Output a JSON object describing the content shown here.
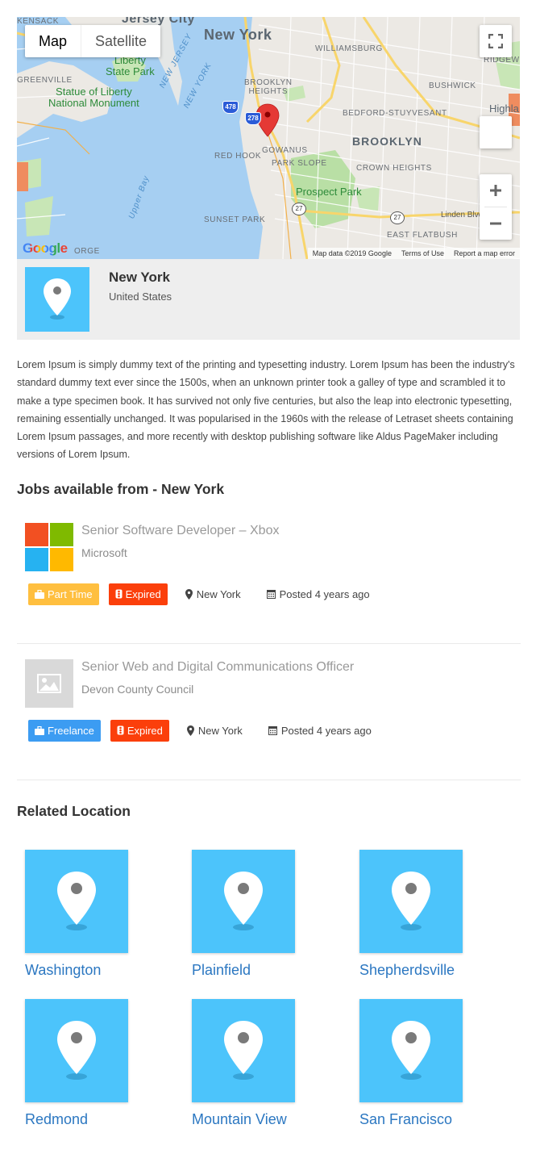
{
  "map": {
    "type_map": "Map",
    "type_satellite": "Satellite",
    "labels": {
      "jersey_city": "Jersey City",
      "new_york": "New York",
      "kensack": "KENSACK",
      "williamsburg": "WILLIAMSBURG",
      "ridgewood": "RIDGEWOOD",
      "liberty_state_park": "Liberty\nState Park",
      "greenville": "GREENVILLE",
      "statue_of_liberty": "Statue of Liberty\nNational Monument",
      "new_jersey": "NEW JERSEY",
      "new_york_water": "NEW YORK",
      "brooklyn_heights": "BROOKLYN\nHEIGHTS",
      "bushwick": "BUSHWICK",
      "bedford": "BEDFORD-STUYVESANT",
      "highland": "Highla",
      "brooklyn": "BROOKLYN",
      "gowanus": "GOWANUS",
      "red_hook": "RED HOOK",
      "park_slope": "PARK SLOPE",
      "crown_heights": "CROWN HEIGHTS",
      "upper_bay": "Upper Bay",
      "prospect_park": "Prospect Park",
      "linden_blvd": "Linden Blvd",
      "sunset_park": "SUNSET PARK",
      "east_flatbush": "EAST FLATBUSH",
      "gorge": "ORGE",
      "shield_478": "478",
      "shield_278": "278",
      "shield_27a": "27",
      "shield_27b": "27"
    },
    "footer": {
      "data": "Map data ©2019 Google",
      "terms": "Terms of Use",
      "report": "Report a map error"
    },
    "google": "Google"
  },
  "location": {
    "name": "New York",
    "country": "United States"
  },
  "description": "Lorem Ipsum is simply dummy text of the printing and typesetting industry. Lorem Ipsum has been the industry's standard dummy text ever since the 1500s, when an unknown printer took a galley of type and scrambled it to make a type specimen book. It has survived not only five centuries, but also the leap into electronic typesetting, remaining essentially unchanged. It was popularised in the 1960s with the release of Letraset sheets containing Lorem Ipsum passages, and more recently with desktop publishing software like Aldus PageMaker including versions of Lorem Ipsum.",
  "jobs_heading": "Jobs available from - New York",
  "jobs": [
    {
      "title": "Senior Software Developer – Xbox",
      "company": "Microsoft",
      "type": "Part Time",
      "type_color": "#ffbf3f",
      "status": "Expired",
      "location": "New York",
      "posted": "Posted 4 years ago",
      "logo": "microsoft-logo"
    },
    {
      "title": "Senior Web and Digital Communications Officer",
      "company": "Devon County Council",
      "type": "Freelance",
      "type_color": "#3c9cf2",
      "status": "Expired",
      "location": "New York",
      "posted": "Posted 4 years ago",
      "logo": "image-placeholder-icon"
    }
  ],
  "related_heading": "Related Location",
  "related": [
    {
      "name": "Washington"
    },
    {
      "name": "Plainfield"
    },
    {
      "name": "Shepherdsville"
    },
    {
      "name": "Redmond"
    },
    {
      "name": "Mountain View"
    },
    {
      "name": "San Francisco"
    }
  ],
  "colors": {
    "pin_box": "#4cc4fb",
    "expired": "#fb3f0b",
    "link": "#2b77c1",
    "map_water": "#a6cff2"
  }
}
